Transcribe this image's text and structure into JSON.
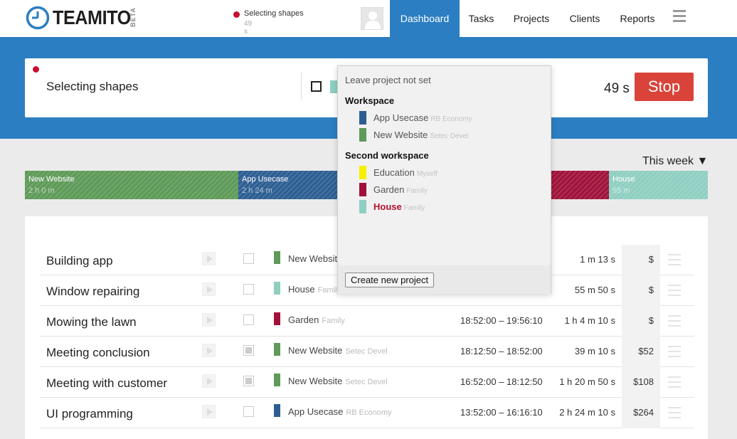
{
  "header": {
    "logo_text": "TEAMITO",
    "logo_badge": "BETA",
    "running": {
      "name": "Selecting shapes",
      "time": "49 s"
    },
    "nav": [
      "Dashboard",
      "Tasks",
      "Projects",
      "Clients",
      "Reports"
    ],
    "active_nav": "Dashboard"
  },
  "timer": {
    "task_name": "Selecting shapes",
    "elapsed": "49 s",
    "stop_label": "Stop",
    "project_color": "#8fcfc2"
  },
  "week_selector": "This week",
  "project_bar": [
    {
      "name": "New Website",
      "duration": "2 h 0 m",
      "color": "#5e9a58"
    },
    {
      "name": "App Usecase",
      "duration": "2 h 24 m",
      "color": "#2c5e92"
    },
    {
      "name": "",
      "duration": "",
      "color": "#a0123a"
    },
    {
      "name": "House",
      "duration": "55 m",
      "color": "#8fcfc2"
    }
  ],
  "project_dropdown": {
    "leave_label": "Leave project not set",
    "groups": [
      {
        "title": "Workspace",
        "items": [
          {
            "name": "App Usecase",
            "client": "RB Economy",
            "color": "#2c5e92"
          },
          {
            "name": "New Website",
            "client": "Setec Devel",
            "color": "#5e9a58"
          }
        ]
      },
      {
        "title": "Second workspace",
        "items": [
          {
            "name": "Education",
            "client": "Myself",
            "color": "#f5ef00"
          },
          {
            "name": "Garden",
            "client": "Family",
            "color": "#a0123a"
          },
          {
            "name": "House",
            "client": "Family",
            "color": "#8fcfc2",
            "selected": true
          }
        ]
      }
    ],
    "create_label": "Create new project"
  },
  "entries": [
    {
      "name": "Building app",
      "billable": false,
      "project": "New Website",
      "client": "",
      "color": "#5e9a58",
      "range": "",
      "duration": "1 m 13 s",
      "cost": "$"
    },
    {
      "name": "Window repairing",
      "billable": false,
      "project": "House",
      "client": "Family",
      "color": "#8fcfc2",
      "range": "",
      "duration": "55 m 50 s",
      "cost": "$"
    },
    {
      "name": "Mowing the lawn",
      "billable": false,
      "project": "Garden",
      "client": "Family",
      "color": "#a0123a",
      "range": "18:52:00 – 19:56:10",
      "duration": "1 h 4 m 10 s",
      "cost": "$"
    },
    {
      "name": "Meeting conclusion",
      "billable": true,
      "project": "New Website",
      "client": "Setec Devel",
      "color": "#5e9a58",
      "range": "18:12:50 – 18:52:00",
      "duration": "39 m 10 s",
      "cost": "$52"
    },
    {
      "name": "Meeting with customer",
      "billable": true,
      "project": "New Website",
      "client": "Setec Devel",
      "color": "#5e9a58",
      "range": "16:52:00 – 18:12:50",
      "duration": "1 h 20 m 50 s",
      "cost": "$108"
    },
    {
      "name": "UI programming",
      "billable": false,
      "project": "App Usecase",
      "client": "RB Economy",
      "color": "#2c5e92",
      "range": "13:52:00 – 16:16:10",
      "duration": "2 h 24 m 10 s",
      "cost": "$264"
    }
  ]
}
